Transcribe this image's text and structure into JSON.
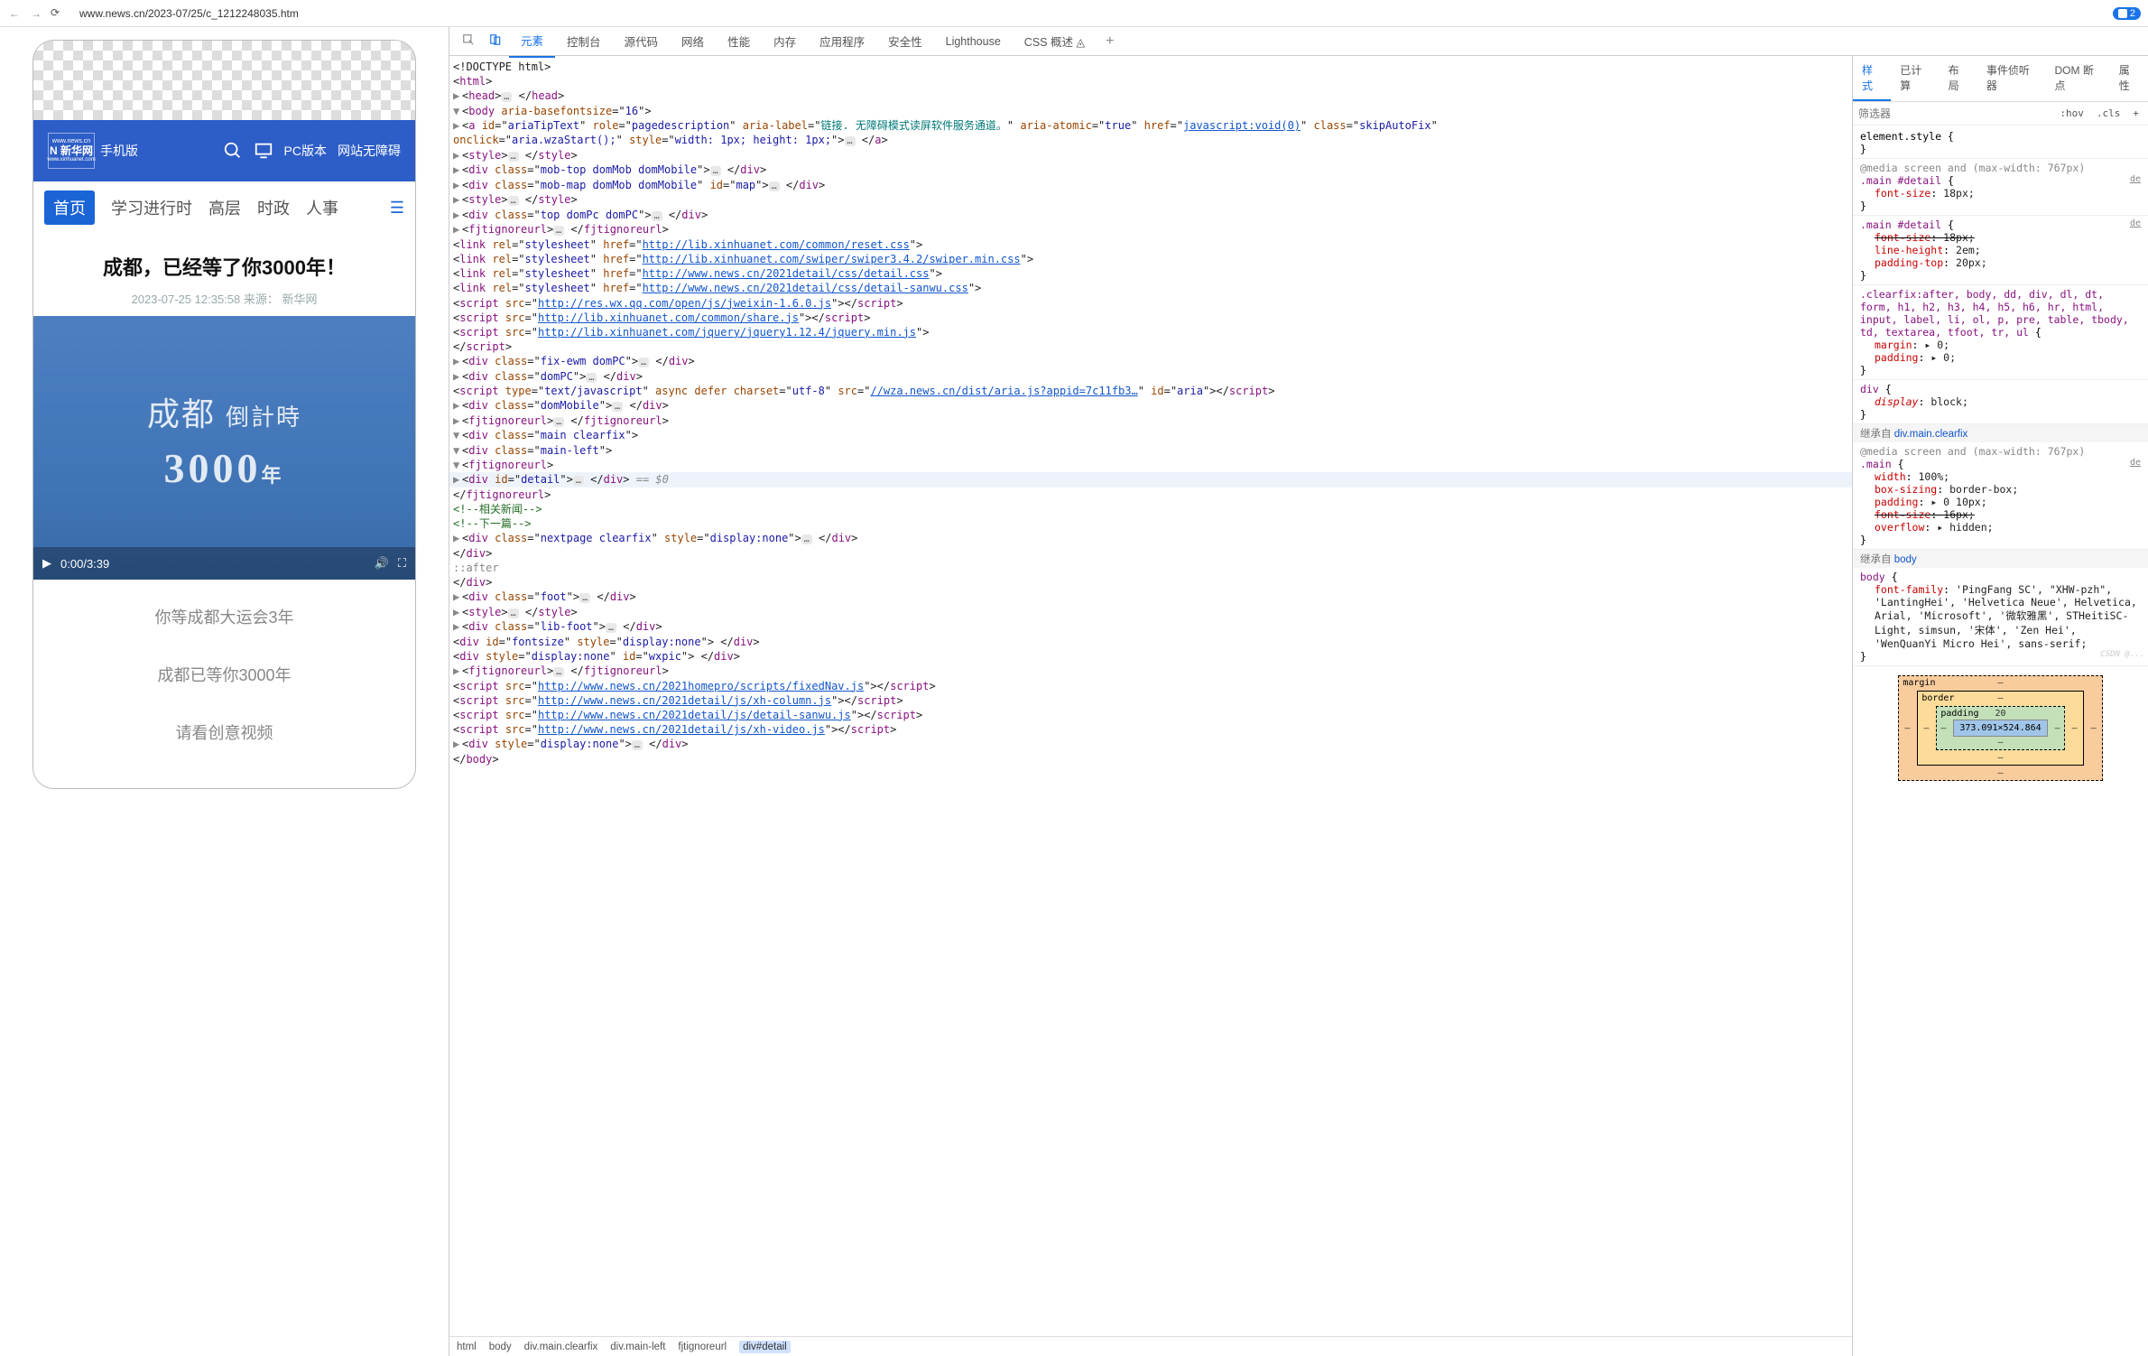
{
  "browser": {
    "url": "www.news.cn/2023-07/25/c_1212248035.htm",
    "badge": "2"
  },
  "devtools_tabs": [
    "元素",
    "控制台",
    "源代码",
    "网络",
    "性能",
    "内存",
    "应用程序",
    "安全性",
    "Lighthouse",
    "CSS 概述 ◬"
  ],
  "preview": {
    "mobile_label": "手机版",
    "header_links": [
      "PC版本",
      "网站无障碍"
    ],
    "nav": [
      "首页",
      "学习进行时",
      "高层",
      "时政",
      "人事"
    ],
    "article_title": "成都，已经等了你3000年！",
    "meta": "2023-07-25 12:35:58 来源：   新华网",
    "video_big": "成都",
    "video_sub": "倒計時",
    "video_year": "3000",
    "video_year_unit": "年",
    "time_current": "0:00",
    "time_total": "3:39",
    "captions": [
      "你等成都大运会3年",
      "成都已等你3000年",
      "请看创意视频"
    ]
  },
  "dom": {
    "doctype": "<!DOCTYPE html>",
    "aria_label": "链接. 无障碍模式读屏软件服务通道。",
    "aria_href": "javascript:void(0)",
    "aria_onclick": "aria.wzaStart();",
    "css_reset": "http://lib.xinhuanet.com/common/reset.css",
    "css_swiper": "http://lib.xinhuanet.com/swiper/swiper3.4.2/swiper.min.css",
    "css_detail": "http://www.news.cn/2021detail/css/detail.css",
    "css_sanwu": "http://www.news.cn/2021detail/css/detail-sanwu.css",
    "js_weixin": "http://res.wx.qq.com/open/js/jweixin-1.6.0.js",
    "js_share": "http://lib.xinhuanet.com/common/share.js",
    "js_jquery": "http://lib.xinhuanet.com/jquery/jquery1.12.4/jquery.min.js",
    "js_aria": "//wza.news.cn/dist/aria.js?appid=7c11fb3…",
    "js_fixednav": "http://www.news.cn/2021homepro/scripts/fixedNav.js",
    "js_xhcol": "http://www.news.cn/2021detail/js/xh-column.js",
    "js_detailsanwu": "http://www.news.cn/2021detail/js/detail-sanwu.js",
    "js_xhvideo": "http://www.news.cn/2021detail/js/xh-video.js",
    "comment1": "<!--相关新闻-->",
    "comment2": "<!--下一篇-->",
    "sel_hint": "== $0"
  },
  "breadcrumb": [
    "html",
    "body",
    "div.main.clearfix",
    "div.main-left",
    "fjtignoreurl",
    "div#detail"
  ],
  "styles_tabs": [
    "样式",
    "已计算",
    "布局",
    "事件侦听器",
    "DOM 断点",
    "属性"
  ],
  "filter_placeholder": "筛选器",
  "filter_btns": [
    ":hov",
    ".cls"
  ],
  "rules": {
    "elstyle": "element.style {",
    "media767": "@media screen and (max-width: 767px)",
    "r1_sel": ".main #detail",
    "r1_p1n": "font-size",
    "r1_p1v": "18px;",
    "r2_p1n": "font-size",
    "r2_p1v": "18px;",
    "r2_p2n": "line-height",
    "r2_p2v": "2em;",
    "r2_p3n": "padding-top",
    "r2_p3v": "20px;",
    "r3_sel": ".clearfix:after, body, dd, div, dl, dt, form, h1, h2, h3, h4, h5, h6, hr, html, input, label, li, ol, p, pre, table, tbody, td, textarea, tfoot, tr, ul",
    "r3_p1n": "margin",
    "r3_p1v": "▸ 0;",
    "r3_p2n": "padding",
    "r3_p2v": "▸ 0;",
    "r4_sel": "div",
    "r4_p1n": "display",
    "r4_p1v": "block;",
    "inherit1": "继承自 ",
    "inherit1_el": "div.main.clearfix",
    "r5_sel": ".main",
    "r5_p1n": "width",
    "r5_p1v": "100%;",
    "r5_p2n": "box-sizing",
    "r5_p2v": "border-box;",
    "r5_p3n": "padding",
    "r5_p3v": "▸ 0 10px;",
    "r5_p4n": "font-size",
    "r5_p4v": "16px;",
    "r5_p5n": "overflow",
    "r5_p5v": "▸ hidden;",
    "inherit2": "继承自 ",
    "inherit2_el": "body",
    "r6_sel": "body",
    "r6_p1n": "font-family",
    "r6_p1v": "'PingFang SC', \"XHW-pzh\", 'LantingHei', 'Helvetica Neue', Helvetica, Arial, 'Microsoft', '微软雅黑', STHeitiSC-Light, simsun, '宋体', 'Zen Hei', 'WenQuanYi Micro Hei', sans-serif;"
  },
  "box": {
    "margin": "margin",
    "border": "border",
    "padding": "padding",
    "pad_top": "20",
    "content": "373.091×524.864",
    "dash": "–"
  }
}
